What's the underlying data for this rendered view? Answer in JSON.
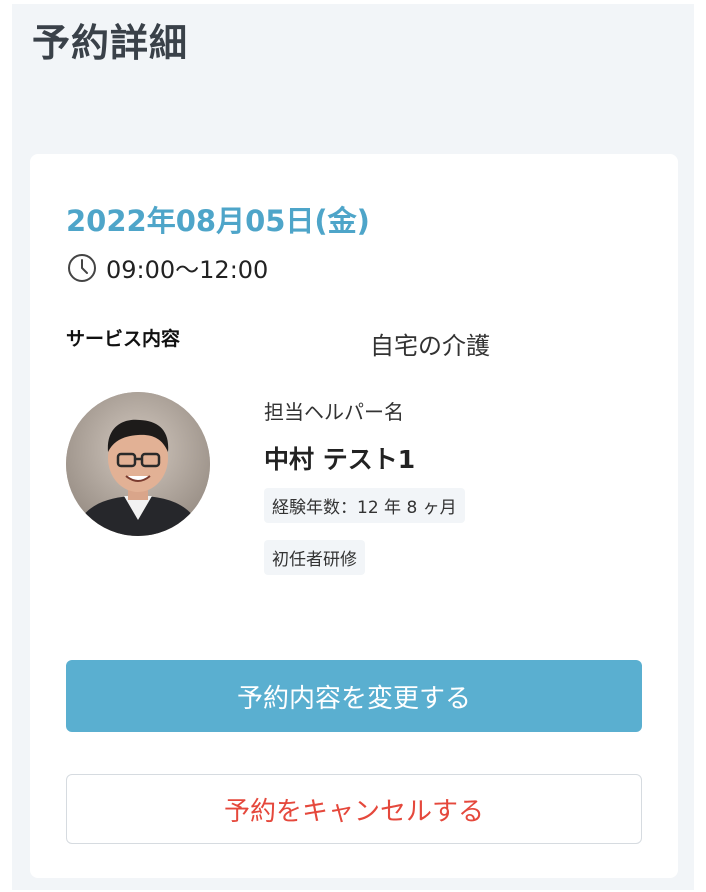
{
  "page": {
    "title": "予約詳細"
  },
  "reservation": {
    "date": "2022年08月05日(金)",
    "time": "09:00〜12:00",
    "service_label": "サービス内容",
    "service_value": "自宅の介護"
  },
  "helper": {
    "label": "担当ヘルパー名",
    "name": "中村 テスト1",
    "experience": "経験年数：12 年 8 ヶ月",
    "qualification": "初任者研修"
  },
  "actions": {
    "change_label": "予約内容を変更する",
    "cancel_label": "予約をキャンセルする"
  },
  "colors": {
    "accent": "#5aafd0",
    "date": "#4ea5c9",
    "danger": "#e5483c",
    "background": "#f2f5f8"
  },
  "icons": {
    "time": "clock-icon",
    "avatar": "helper-photo"
  }
}
